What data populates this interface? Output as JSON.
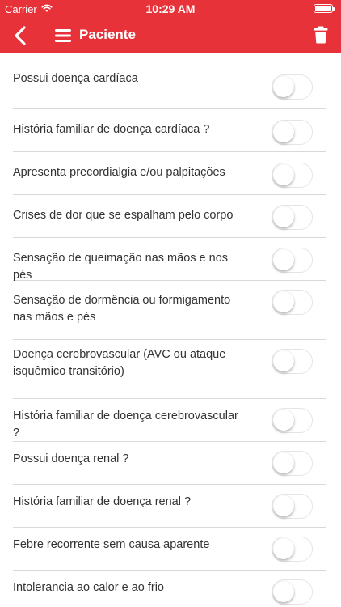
{
  "status_bar": {
    "carrier": "Carrier",
    "time": "10:29 AM"
  },
  "nav": {
    "title": "Paciente",
    "icons": [
      "back-chevron-icon",
      "menu-icon",
      "trash-icon"
    ]
  },
  "colors": {
    "accent": "#e7323a",
    "divider": "#d9d9d9",
    "text": "#333333"
  },
  "questions": [
    {
      "label": "Possui doença cardíaca",
      "on": false
    },
    {
      "label": "História familiar de doença cardíaca ?",
      "on": false
    },
    {
      "label": "Apresenta precordialgia e/ou palpitações",
      "on": false
    },
    {
      "label": "Crises de dor que se espalham pelo corpo",
      "on": false
    },
    {
      "label": "Sensação de queimação nas mãos e nos pés",
      "on": false
    },
    {
      "label": "Sensação de dormência ou formigamento nas mãos e pés",
      "on": false
    },
    {
      "label": "Doença cerebrovascular (AVC ou ataque isquêmico transitório)",
      "on": false
    },
    {
      "label": "História familiar de doença cerebrovascular ?",
      "on": false
    },
    {
      "label": "Possui doença renal ?",
      "on": false
    },
    {
      "label": "História familiar de doença renal ?",
      "on": false
    },
    {
      "label": "Febre recorrente sem causa aparente",
      "on": false
    },
    {
      "label": "Intolerancia ao calor e ao frio",
      "on": false
    }
  ]
}
